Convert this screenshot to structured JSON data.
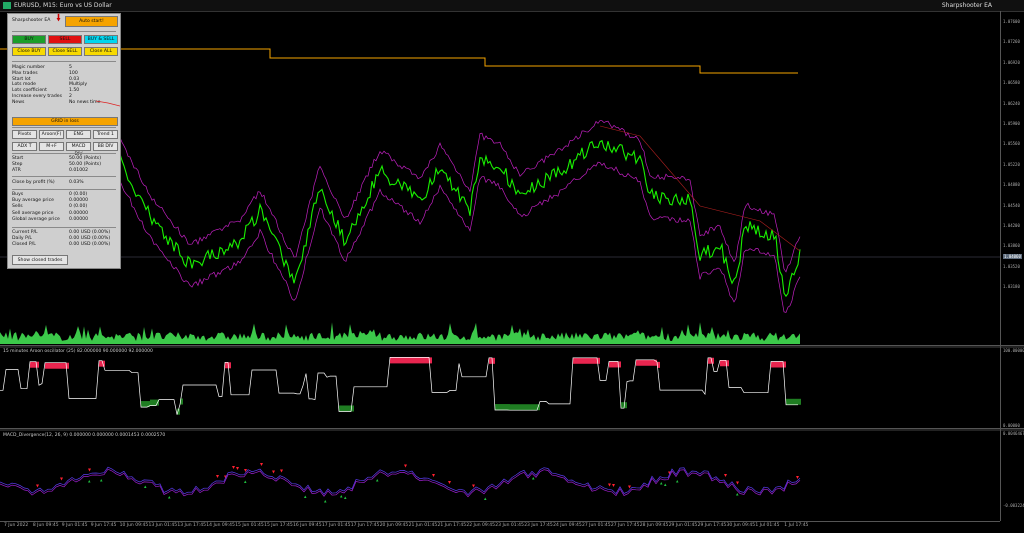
{
  "window": {
    "title": "EURUSD, M15:  Euro vs US Dollar",
    "ea_tag": "Sharpshooter EA"
  },
  "price_scale": [
    "1.07600",
    "1.07260",
    "1.06920",
    "1.06580",
    "1.06240",
    "1.05900",
    "1.05560",
    "1.05220",
    "1.04880",
    "1.04540",
    "1.04200",
    "1.03860",
    "1.03520",
    "1.03180"
  ],
  "current_price": "1.04060",
  "oscillator_scale": [
    "100.00000",
    "0.00000"
  ],
  "macd_scale": [
    "0.0046467",
    "-0.0032245"
  ],
  "time_labels": [
    "7 Jun 2022",
    "8 Jun 09:45",
    "9 Jun 01:45",
    "9 Jun 17:45",
    "10 Jun 09:45",
    "13 Jun 01:45",
    "13 Jun 17:45",
    "14 Jun 09:45",
    "15 Jun 01:45",
    "15 Jun 17:45",
    "16 Jun 09:45",
    "17 Jun 01:45",
    "17 Jun 17:45",
    "20 Jun 09:45",
    "21 Jun 01:45",
    "21 Jun 17:45",
    "22 Jun 09:45",
    "23 Jun 01:45",
    "23 Jun 17:45",
    "24 Jun 09:45",
    "27 Jun 01:45",
    "27 Jun 17:45",
    "28 Jun 09:45",
    "29 Jun 01:45",
    "29 Jun 17:45",
    "30 Jun 09:45",
    "1 Jul 01:45",
    "1 Jul 17:45"
  ],
  "subwindows": {
    "aroon_title": "15 minutes Aroon oscillator (25) 82.000000 90.000000 92.000000",
    "macd_title": "MACD_Divergence(12, 26, 9) 0.000000 0.000000 0.0001453 0.0002570"
  },
  "panel": {
    "title": "Sharpshooter EA",
    "auto_start": "Auto start!",
    "buy": "BUY",
    "sell": "SELL",
    "buy_sell": "BUY & SELL",
    "close_buy": "Close BUY",
    "close_sell": "Close SELL",
    "close_all": "Close ALL",
    "settings": [
      {
        "k": "Magic number",
        "v": "5"
      },
      {
        "k": "Max trades",
        "v": "100"
      },
      {
        "k": "Start lot",
        "v": "0.03"
      },
      {
        "k": "Lots mode",
        "v": "Multiply"
      },
      {
        "k": "Lots coefficient",
        "v": "1.50"
      },
      {
        "k": "Increase every trades",
        "v": "2"
      },
      {
        "k": "News",
        "v": "No news time"
      }
    ],
    "grid_in_loss": "GRID in loss",
    "signals_row1": [
      "Pivots",
      "Aroon(F)",
      "ENG",
      "Trend 1"
    ],
    "signals_row2": [
      "ADX T",
      "M+F",
      "MACD DIV",
      "BB DIV"
    ],
    "levels": [
      {
        "k": "Start",
        "v": "50.00 (Points)"
      },
      {
        "k": "Step",
        "v": "50.00 (Points)"
      },
      {
        "k": "ATR",
        "v": "0.01002"
      }
    ],
    "close_by_profit": {
      "k": "Close by profit (%)",
      "v": "0.03%"
    },
    "stats": [
      {
        "k": "Buys",
        "v": "0 (0.00)"
      },
      {
        "k": "Buy average price",
        "v": "0.00000"
      },
      {
        "k": "Sells",
        "v": "0 (0.00)"
      },
      {
        "k": "Sell average price",
        "v": "0.00000"
      },
      {
        "k": "Global average price",
        "v": "0.00000"
      }
    ],
    "pl": [
      {
        "k": "Current P/L",
        "v": "0.00 USD (0.00%)"
      },
      {
        "k": "Daily P/L",
        "v": "0.00 USD (0.00%)"
      },
      {
        "k": "Closed P/L",
        "v": "0.00 USD (0.00%)"
      }
    ],
    "show_closed": "Show closed trades"
  },
  "colors": {
    "bg": "#000000",
    "price": "#19f000",
    "bands": "#c020c0",
    "level": "#f5a300",
    "volume": "#3cc94a",
    "aroon_pos": "#e8254f",
    "aroon_neg": "#1f7d22",
    "macd_line": "#5a3cf0",
    "macd_signal": "#a020d0"
  }
}
